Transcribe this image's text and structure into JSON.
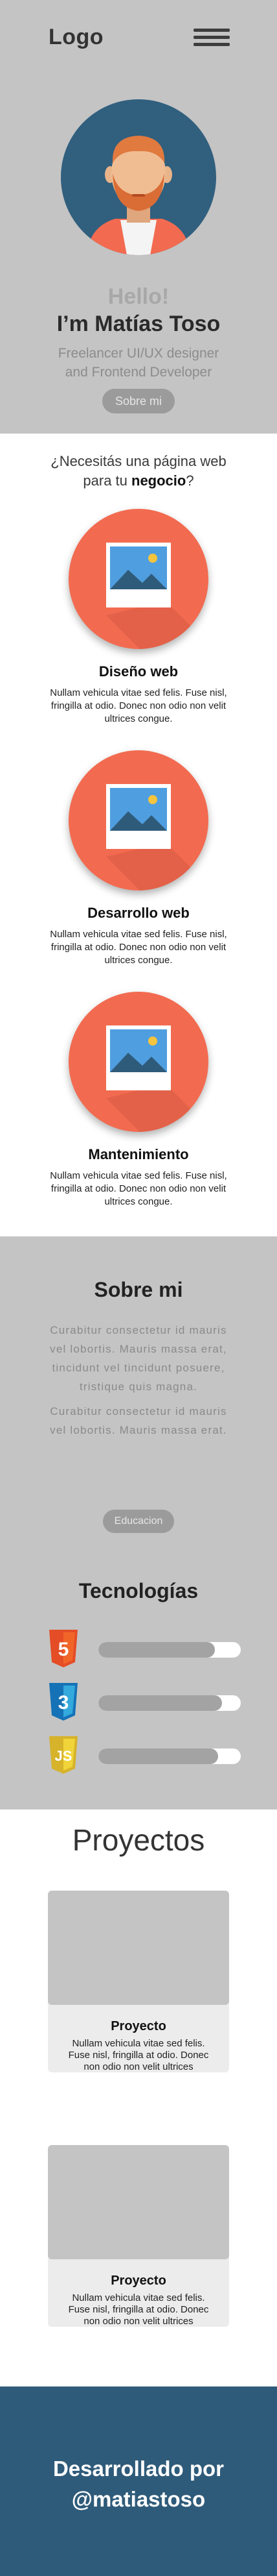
{
  "nav": {
    "logo": "Logo",
    "menu_icon": "hamburger-menu-icon"
  },
  "hero": {
    "avatar_icon": "avatar-man-beard-icon",
    "greeting": "Hello!",
    "name": "I’m Matías Toso",
    "role_line1": "Freelancer UI/UX designer",
    "role_line2": "and Frontend Developer",
    "button_label": "Sobre mi"
  },
  "services": {
    "question_prefix": "¿Necesitás una página web",
    "question_middle": "para tu ",
    "question_bold": "negocio",
    "question_suffix": "?",
    "items": [
      {
        "icon": "image-placeholder-icon",
        "title": "Diseño web",
        "text": "Nullam vehicula vitae sed felis. Fuse nisl, fringilla at odio. Donec non odio non velit ultrices congue."
      },
      {
        "icon": "image-placeholder-icon",
        "title": "Desarrollo web",
        "text": "Nullam vehicula vitae sed felis. Fuse nisl, fringilla at odio. Donec non odio non velit ultrices congue."
      },
      {
        "icon": "image-placeholder-icon",
        "title": "Mantenimiento",
        "text": "Nullam vehicula vitae sed felis. Fuse nisl, fringilla at odio. Donec non odio non velit ultrices congue."
      }
    ]
  },
  "about": {
    "title": "Sobre mi",
    "paragraph1": "Curabitur consectetur id mauris vel lobortis. Mauris massa erat, tincidunt vel tincidunt posuere, tristique quis magna.",
    "paragraph2": "Curabitur consectetur id mauris vel lobortis. Mauris massa erat.",
    "button_label": "Educacion"
  },
  "tech": {
    "title": "Tecnologías",
    "items": [
      {
        "icon": "html5-logo-icon",
        "label": "5",
        "color": "#e44d26",
        "level": 0.82
      },
      {
        "icon": "css3-logo-icon",
        "label": "3",
        "color": "#1572b6",
        "level": 0.87
      },
      {
        "icon": "js-logo-icon",
        "label": "JS",
        "color": "#d6b32a",
        "level": 0.84
      }
    ]
  },
  "projects": {
    "title": "Proyectos",
    "items": [
      {
        "name": "Proyecto",
        "desc": "Nullam vehicula vitae sed felis. Fuse nisl, fringilla at odio. Donec non odio non velit ultrices congue."
      },
      {
        "name": "Proyecto",
        "desc": "Nullam vehicula vitae sed felis. Fuse nisl, fringilla at odio. Donec non odio non velit ultrices congue."
      }
    ]
  },
  "footer": {
    "line1": "Desarrollado por",
    "line2": "@matiastoso"
  },
  "colors": {
    "hero_bg": "#c4c4c4",
    "accent_circle": "#f26b50",
    "avatar_bg": "#315f7e",
    "footer_bg": "#2f5b7a"
  }
}
